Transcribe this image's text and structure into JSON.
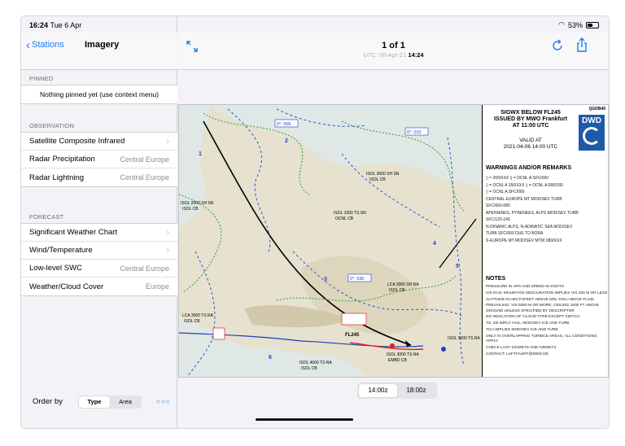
{
  "status": {
    "time": "16:24",
    "date": "Tue 6 Apr",
    "battery": "53%",
    "battery_level": 0.53
  },
  "sidebar": {
    "back_label": "Stations",
    "title": "Imagery",
    "pinned": {
      "header": "PINNED",
      "empty_text": "Nothing pinned yet (use context menu)"
    },
    "observation": {
      "header": "OBSERVATION",
      "items": [
        {
          "label": "Satellite Composite Infrared",
          "value": ""
        },
        {
          "label": "Radar Precipitation",
          "value": "Central Europe"
        },
        {
          "label": "Radar Lightning",
          "value": "Central Europe"
        }
      ]
    },
    "forecast": {
      "header": "FORECAST",
      "items": [
        {
          "label": "Significant Weather Chart",
          "value": ""
        },
        {
          "label": "Wind/Temperature",
          "value": ""
        },
        {
          "label": "Low-level SWC",
          "value": "Central Europe"
        },
        {
          "label": "Weather/Cloud Cover",
          "value": "Europe"
        }
      ]
    },
    "order": {
      "label": "Order by",
      "options": [
        "Type",
        "Area"
      ],
      "selected": "Type"
    }
  },
  "main": {
    "title": "1 of 1",
    "subtitle_prefix": "UTC: 06-Apr-21",
    "subtitle_time": "14:24",
    "times": [
      "14:00z",
      "18:00z"
    ],
    "selected_time": "14:00z"
  },
  "chart": {
    "heading": [
      "SIGWX BELOW FL245",
      "ISSUED BY MWO Frankfurt",
      "AT 11:00 UTC"
    ],
    "code": "QGDB40",
    "logo": "DWD",
    "valid": [
      "VALID AT",
      "2021-04-06 14:00 UTC"
    ],
    "warnings_header": "WARNINGS AND/OR REMARKS",
    "warnings": [
      "▯ = 200/XXX  ▯ = OCNL A SFC/060",
      "▯ = OCNL A 150/XXX  ▯ = OCNL A 080/180",
      "▯ = OCNL A SFC/060",
      "CENTRAL EUROPE MT MOD/SEV TURB",
      "SFC/060-080",
      "APENNINES, PYRENEES, ALPS MOD/SEV TURB",
      "SFC/120-140",
      "N-DINARIC ALPS, N-ADRIATIC SEA MOD/SEV",
      "TURB SFC/060 DUE TO BORA",
      "S-EUROPE MT MOD/SEV MTW 080/XXX"
    ],
    "notes_header": "NOTES",
    "notes": [
      "PRESSURE IN HPA AND SPEED IN KNOTS",
      "VIS IN M, MOUNTAIN OBSCURATION IMPLIES VIS 200 M OR LESS",
      "ALTITUDE IN HECTOFEET ABOVE MSL XXX=ABOVE FL245",
      "PREVAILING: VIS 5000 M OR MORE, CEILING 1500 FT ABOVE GROUND UNLESS SPECIFIED BY DESCRIPTOR",
      "NO INDICATION OF CLOUD TYPE EXCEPT CB/TCU",
      "TS, CB IMPLY HAIL, MOD/SEV ICE AND TURB",
      "TCU IMPLIES MOD/SEV ICE AND TURB",
      "ONLY IN OVERLAPPING TURBICE AREAS, ALL CONDITIONS APPLY",
      "CHECK LAST SIGMETS AND AIRMETS",
      "CONTACT: LUFTFAHRT@DWD.DE"
    ],
    "map_labels": {
      "a1": "ISOL 3000 SH SN",
      "a2": "ISOL CB",
      "b1": "ISOL 1000 TS SN",
      "b2": "OCNL CB",
      "c1": "ISOL 2000 SH SN",
      "c2": "ISOL CB",
      "d1": "LCA 3000 SH RA",
      "d2": "ISOL CB",
      "e1": "ISOL 3000 TS RA",
      "e2": "EMBD CB",
      "f1": "ISOL 4000 TS RA",
      "f2": "ISOL CB",
      "g1": "LCA 3000 TS RA",
      "g2": "ISOL CB",
      "fl": "FL245",
      "zero1": "0°: 005",
      "zero2": "0°: 010",
      "zero3": "0°: 030",
      "n1": "1",
      "n2": "2",
      "n3": "3",
      "n4": "4",
      "n5": "5",
      "n6": "6"
    }
  }
}
